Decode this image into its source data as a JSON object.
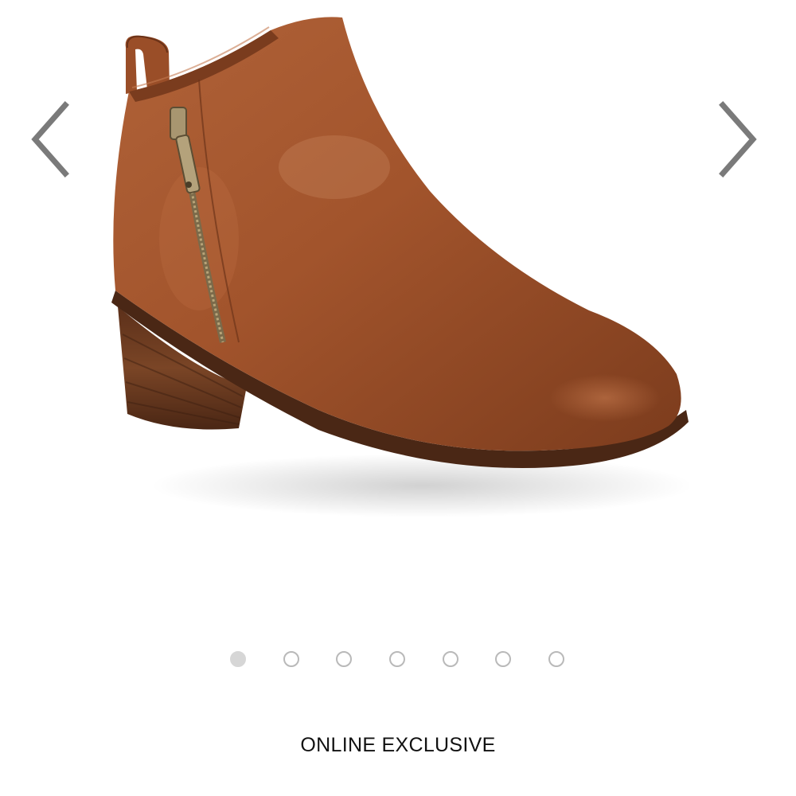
{
  "gallery": {
    "image_icon": "ankle-boot-product-photo",
    "prev_icon": "chevron-left-icon",
    "next_icon": "chevron-right-icon",
    "arrow_color": "#7a7a7a",
    "slide_count": 7,
    "active_slide": 1
  },
  "product": {
    "badge": "ONLINE EXCLUSIVE",
    "title": ""
  }
}
